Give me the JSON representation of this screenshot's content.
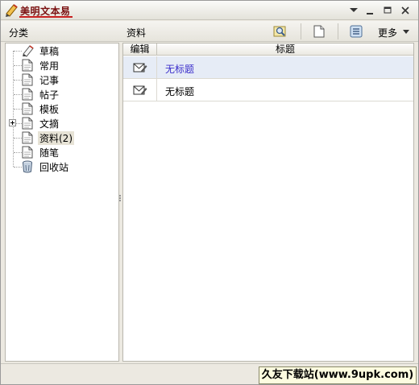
{
  "window": {
    "title": "美明文本易",
    "icons": {
      "app": "app-logo-icon",
      "menu": "dropdown-menu-icon",
      "minimize": "minimize-icon",
      "maximize": "maximize-icon",
      "close": "close-icon"
    }
  },
  "header": {
    "category_label": "分类",
    "current_folder": "资料",
    "more_label": "更多",
    "toolbar_icons": [
      "search-icon",
      "new-document-icon",
      "list-view-icon"
    ]
  },
  "tree": {
    "items": [
      {
        "label": "草稿",
        "icon": "draft-pen-icon"
      },
      {
        "label": "常用",
        "icon": "document-icon"
      },
      {
        "label": "记事",
        "icon": "document-icon"
      },
      {
        "label": "帖子",
        "icon": "document-icon"
      },
      {
        "label": "模板",
        "icon": "document-icon"
      },
      {
        "label": "文摘",
        "icon": "document-icon",
        "expandable": true
      },
      {
        "label": "资料(2)",
        "icon": "document-icon",
        "selected": true
      },
      {
        "label": "随笔",
        "icon": "document-icon"
      },
      {
        "label": "回收站",
        "icon": "recycle-bin-icon"
      }
    ]
  },
  "list": {
    "columns": {
      "edit": "编辑",
      "title": "标题"
    },
    "rows": [
      {
        "title": "无标题",
        "selected": true
      },
      {
        "title": "无标题",
        "selected": false
      }
    ]
  },
  "status": {
    "watermark": "久友下载站(www.9upk.com)"
  },
  "colors": {
    "selected_row_bg": "#e6ecf6",
    "selected_row_text": "#3b2ecb",
    "title_text": "#7a1010"
  }
}
